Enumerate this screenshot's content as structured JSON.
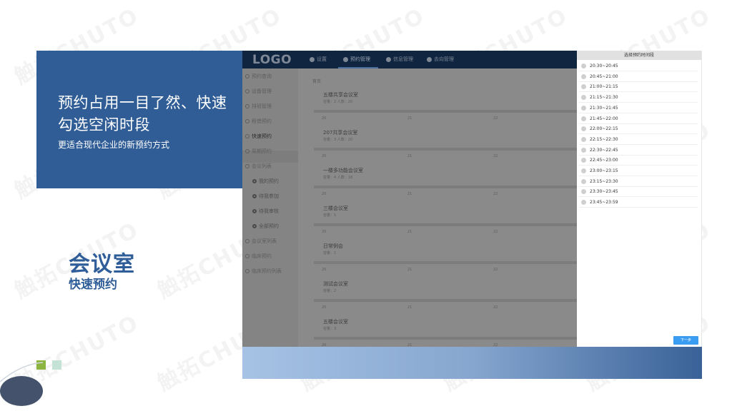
{
  "slide": {
    "hero_title": "预约占用一目了然、快速勾选空闲时段",
    "hero_subtitle": "更适合现代企业的新预约方式",
    "heading": "会议室",
    "subheading": "快速预约",
    "watermark": "触拓CHUTO"
  },
  "app": {
    "logo": "LOGO",
    "nav": [
      "设置",
      "预约管理",
      "信息管理",
      "去向管理"
    ],
    "active_nav": "预约管理",
    "sidebar": [
      {
        "label": "预约查询",
        "sub": false
      },
      {
        "label": "设备管理",
        "sub": false
      },
      {
        "label": "排班管理",
        "sub": false
      },
      {
        "label": "租借预约",
        "sub": false
      },
      {
        "label": "快速预约",
        "sub": false,
        "active": true
      },
      {
        "label": "周期预约",
        "sub": false
      },
      {
        "label": "会议列表",
        "sub": false
      },
      {
        "label": "我的预约",
        "sub": true
      },
      {
        "label": "待我参加",
        "sub": true
      },
      {
        "label": "待我审核",
        "sub": true
      },
      {
        "label": "全部预约",
        "sub": true
      },
      {
        "label": "会议室列表",
        "sub": false
      },
      {
        "label": "临床预约",
        "sub": false
      },
      {
        "label": "临床预约列表",
        "sub": false
      }
    ],
    "breadcrumb": "首页",
    "rooms": [
      {
        "name": "五楼共享会议室",
        "meta": "容量：2    人数：20"
      },
      {
        "name": "207共享会议室",
        "meta": "容量：3    人数：20"
      },
      {
        "name": "一楼多功能会议室",
        "meta": "容量：4    人数：18"
      },
      {
        "name": "三楼会议室",
        "meta": "容量：5"
      },
      {
        "name": "日常例会",
        "meta": "容量：1"
      },
      {
        "name": "测试会议室",
        "meta": "容量：2"
      },
      {
        "name": "五楼会议室",
        "meta": "容量：3"
      }
    ],
    "ticks": [
      "20",
      "21",
      "22"
    ]
  },
  "picker": {
    "title": "选择预约时间段",
    "slots": [
      "20:30~20:45",
      "20:45~21:00",
      "21:00~21:15",
      "21:15~21:30",
      "21:30~21:45",
      "21:45~22:00",
      "22:00~22:15",
      "22:15~22:30",
      "22:30~22:45",
      "22:45~23:00",
      "23:00~23:15",
      "23:15~23:30",
      "23:30~23:45",
      "23:45~23:59"
    ],
    "next_label": "下一步"
  }
}
